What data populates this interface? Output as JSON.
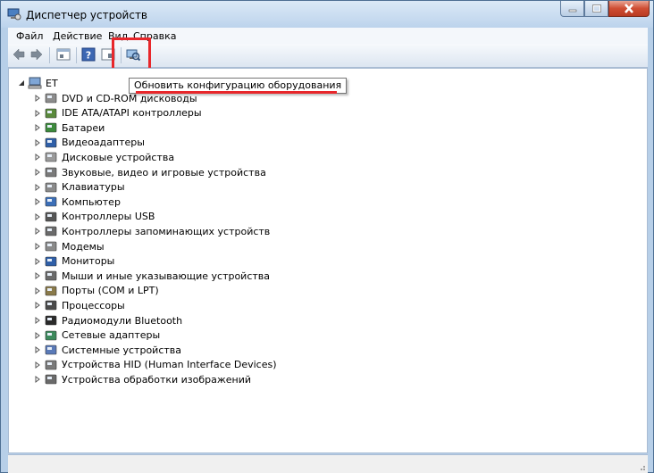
{
  "window": {
    "title": "Диспетчер устройств",
    "accent_close": "#cf4d33",
    "highlight_color": "#e8272b"
  },
  "menu": {
    "file": "Файл",
    "action": "Действие",
    "view": "Вид",
    "help": "Справка"
  },
  "toolbar": {
    "icons": [
      "back-arrow-icon",
      "forward-arrow-icon",
      "properties-icon",
      "help-icon",
      "console-tree-icon",
      "scan-hardware-icon"
    ],
    "tooltip": "Обновить конфигурацию оборудования"
  },
  "tree": {
    "root": "ET",
    "items": [
      {
        "label": "DVD и CD-ROM дисководы",
        "icon": "dvd-drive-icon"
      },
      {
        "label": "IDE ATA/ATAPI контроллеры",
        "icon": "ide-controller-icon"
      },
      {
        "label": "Батареи",
        "icon": "battery-icon"
      },
      {
        "label": "Видеоадаптеры",
        "icon": "display-adapter-icon"
      },
      {
        "label": "Дисковые устройства",
        "icon": "disk-drive-icon"
      },
      {
        "label": "Звуковые, видео и игровые устройства",
        "icon": "sound-icon"
      },
      {
        "label": "Клавиатуры",
        "icon": "keyboard-icon"
      },
      {
        "label": "Компьютер",
        "icon": "computer-icon"
      },
      {
        "label": "Контроллеры USB",
        "icon": "usb-icon"
      },
      {
        "label": "Контроллеры запоминающих устройств",
        "icon": "storage-controller-icon"
      },
      {
        "label": "Модемы",
        "icon": "modem-icon"
      },
      {
        "label": "Мониторы",
        "icon": "monitor-icon"
      },
      {
        "label": "Мыши и иные указывающие устройства",
        "icon": "mouse-icon"
      },
      {
        "label": "Порты (COM и LPT)",
        "icon": "port-icon"
      },
      {
        "label": "Процессоры",
        "icon": "processor-icon"
      },
      {
        "label": "Радиомодули Bluetooth",
        "icon": "bluetooth-icon"
      },
      {
        "label": "Сетевые адаптеры",
        "icon": "network-adapter-icon"
      },
      {
        "label": "Системные устройства",
        "icon": "system-device-icon"
      },
      {
        "label": "Устройства HID (Human Interface Devices)",
        "icon": "hid-icon"
      },
      {
        "label": "Устройства обработки изображений",
        "icon": "imaging-device-icon"
      }
    ]
  }
}
